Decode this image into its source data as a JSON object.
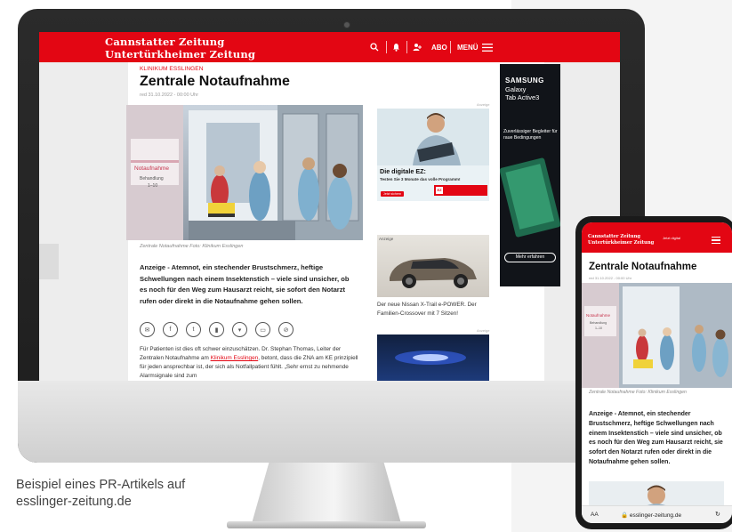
{
  "site": {
    "logo_line1": "Cannstatter Zeitung",
    "logo_line2": "Untertürkheimer Zeitung",
    "nav_abo": "ABO",
    "nav_menu": "MENÜ",
    "search_icon": "search-icon",
    "bell_icon": "bell-icon",
    "user_icon": "user-icon",
    "brand_color": "#e30613"
  },
  "article": {
    "kicker": "KLINIKUM ESSLINGEN",
    "title": "Zentrale Notaufnahme",
    "date": "red 31.10.2022 - 00:00 Uhr",
    "sign_text1": "Notaufnahme",
    "sign_text2": "Behandlung",
    "sign_text3": "1–10",
    "caption": "Zentrale Notaufnahme Foto: Klinikum Esslingen",
    "lead": "Anzeige - Atemnot, ein stechender Brustschmerz, heftige Schwellungen nach einem Insektenstich – viele sind unsicher, ob es noch für den Weg zum Hausarzt reicht, sie sofort den Notarzt rufen oder direkt in die Notaufnahme gehen sollen.",
    "body_before_link": "Für Patienten ist dies oft schwer einzuschätzen. Dr. Stephan Thomas, Leiter der Zentralen Notaufnahme am ",
    "body_link": "Klinikum Esslingen",
    "body_after_link": ", betont, dass die ZNA am KE prinzipiell für jeden ansprechbar ist, der sich als Notfallpatient fühlt. „Sehr ernst zu nehmende Alarmsignale sind zum",
    "share_icons": [
      "mail-icon",
      "facebook-icon",
      "twitter-icon",
      "flipboard-icon",
      "pocket-icon",
      "print-icon",
      "link-icon"
    ]
  },
  "ads": {
    "ad_label": "Anzeige",
    "ad1_title": "Die digitale EZ:",
    "ad1_sub": "Testen Sie 3 Monate das volle Programm!",
    "ad1_button": "Jetzt sichern",
    "ad1_logo": "EZ",
    "ad2_label": "Anzeige",
    "ad2_caption": "Der neue Nissan X-Trail e-POWER. Der Familien-Crossover mit 7 Sitzen!",
    "sky_brand": "SAMSUNG",
    "sky_product": "Galaxy\nTab Active3",
    "sky_tagline": "Zuverlässiger Begleiter für raue Bedingungen",
    "sky_button": "Mehr erfahren"
  },
  "phone": {
    "logo_line1": "Cannstatter Zeitung",
    "logo_line2": "Untertürkheimer Zeitung",
    "badge": "Jetzt digital",
    "title": "Zentrale Notaufnahme",
    "date": "red 31.10.2022 - 00:00 Uhr",
    "sign_text1": "Notaufnahme",
    "sign_text2": "Behandlung",
    "sign_text3": "1–10",
    "caption": "Zentrale Notaufnahme Foto: Klinikum Esslingen",
    "lead": "Anzeige - Atemnot, ein stechender Brustschmerz, heftige Schwellungen nach einem Insektenstich – viele sind unsicher, ob es noch für den Weg zum Hausarzt reicht, sie sofort den Notarzt rufen oder direkt in die Notaufnahme gehen sollen.",
    "aa": "AA",
    "url": "esslinger-zeitung.de",
    "reload_icon": "reload-icon"
  },
  "caption": {
    "line1": "Beispiel eines PR-Artikels auf",
    "line2": "esslinger-zeitung.de"
  }
}
